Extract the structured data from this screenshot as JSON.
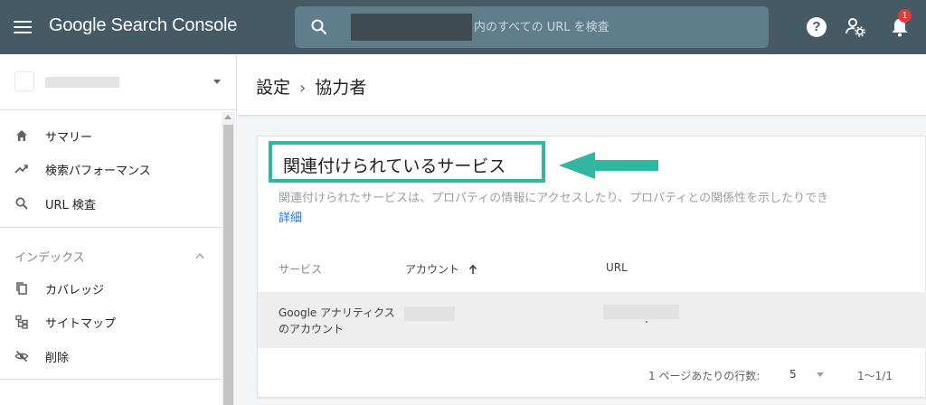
{
  "topbar": {
    "app_title": "Google Search Console",
    "search_placeholder": "内のすべての URL を検査",
    "notification_count": "1",
    "icons": [
      "menu-icon",
      "search-icon",
      "help-icon",
      "user-settings-icon",
      "bell-icon"
    ]
  },
  "sidebar": {
    "items": [
      {
        "label": "サマリー",
        "icon": "home-icon"
      },
      {
        "label": "検索パフォーマンス",
        "icon": "trending-icon"
      },
      {
        "label": "URL 検査",
        "icon": "search-icon"
      }
    ],
    "index_section": {
      "title": "インデックス",
      "items": [
        {
          "label": "カバレッジ",
          "icon": "coverage-icon"
        },
        {
          "label": "サイトマップ",
          "icon": "sitemap-icon"
        },
        {
          "label": "削除",
          "icon": "removals-icon"
        }
      ]
    }
  },
  "breadcrumb": {
    "parent": "設定",
    "separator": "›",
    "current": "協力者"
  },
  "card": {
    "title": "関連付けられているサービス",
    "description": "関連付けられたサービスは、プロパティの情報にアクセスしたり、プロパティとの関係性を示したりでき",
    "detail_link": "詳細",
    "highlight_color": "#33b5a3",
    "table": {
      "columns": [
        "サービス",
        "アカウント",
        "URL"
      ],
      "sort_column": "アカウント",
      "sort_direction": "ascending",
      "rows": [
        {
          "service": "Google アナリティクスのアカウント"
        }
      ]
    },
    "pagination": {
      "rows_per_page_label": "1 ページあたりの行数:",
      "rows_per_page": "5",
      "range": "1～1/1"
    }
  },
  "colors": {
    "topbar": "#455a64",
    "accent": "#33b5a3",
    "link": "#1a73e8"
  }
}
